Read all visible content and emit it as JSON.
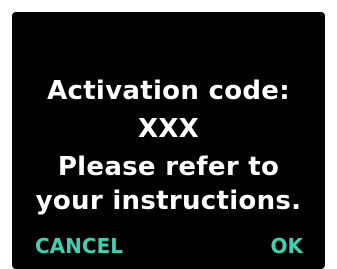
{
  "dialog": {
    "title": "Activation code:",
    "code": "XXX",
    "message_line1": "Please refer to",
    "message_line2": "your instructions."
  },
  "buttons": {
    "cancel": "CANCEL",
    "ok": "OK"
  },
  "colors": {
    "background": "#000000",
    "text": "#ffffff",
    "accent": "#3fd0b0"
  }
}
